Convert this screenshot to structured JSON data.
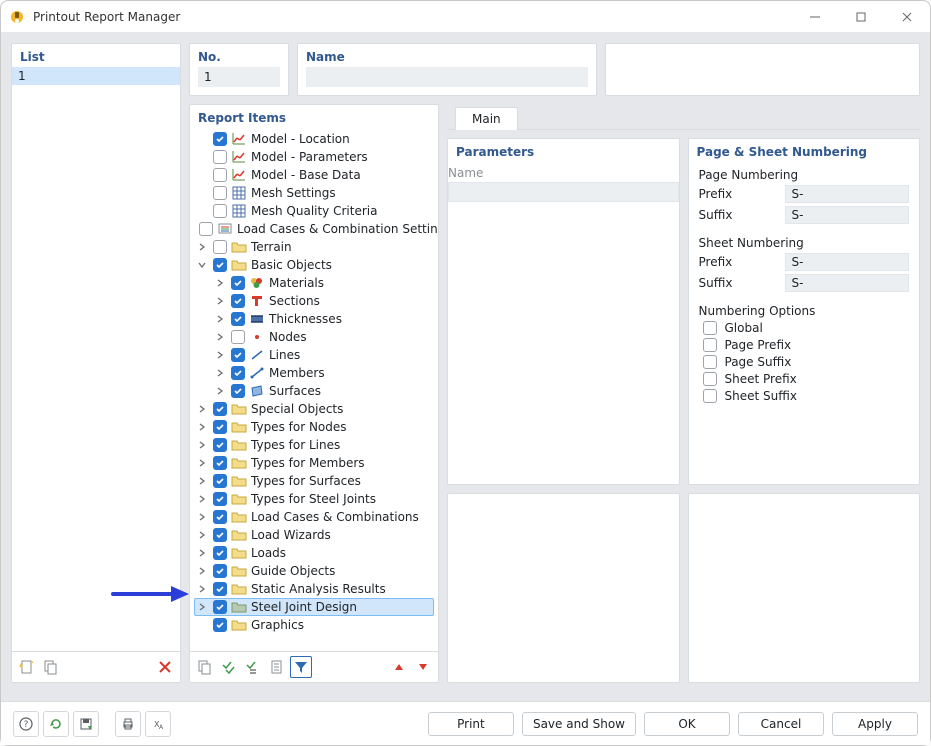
{
  "window": {
    "title": "Printout Report Manager"
  },
  "list": {
    "heading": "List",
    "items": [
      "1"
    ]
  },
  "hdr": {
    "no_label": "No.",
    "no_value": "1",
    "name_label": "Name",
    "name_value": ""
  },
  "tree": {
    "heading": "Report Items",
    "items": [
      {
        "depth": 0,
        "exp": "",
        "chk": true,
        "icon": "chart-green",
        "label": "Model - Location"
      },
      {
        "depth": 0,
        "exp": "",
        "chk": false,
        "icon": "chart-green",
        "label": "Model - Parameters"
      },
      {
        "depth": 0,
        "exp": "",
        "chk": false,
        "icon": "chart-green",
        "label": "Model - Base Data"
      },
      {
        "depth": 0,
        "exp": "",
        "chk": false,
        "icon": "mesh",
        "label": "Mesh Settings"
      },
      {
        "depth": 0,
        "exp": "",
        "chk": false,
        "icon": "mesh",
        "label": "Mesh Quality Criteria"
      },
      {
        "depth": 0,
        "exp": "",
        "chk": false,
        "icon": "load",
        "label": "Load Cases & Combination Settings"
      },
      {
        "depth": 0,
        "exp": "closed",
        "chk": false,
        "icon": "folder",
        "label": "Terrain"
      },
      {
        "depth": 0,
        "exp": "open",
        "chk": true,
        "icon": "folder",
        "label": "Basic Objects"
      },
      {
        "depth": 1,
        "exp": "closed",
        "chk": true,
        "icon": "materials",
        "label": "Materials"
      },
      {
        "depth": 1,
        "exp": "closed",
        "chk": true,
        "icon": "section",
        "label": "Sections"
      },
      {
        "depth": 1,
        "exp": "closed",
        "chk": true,
        "icon": "thickness",
        "label": "Thicknesses"
      },
      {
        "depth": 1,
        "exp": "closed",
        "chk": false,
        "icon": "node",
        "label": "Nodes"
      },
      {
        "depth": 1,
        "exp": "closed",
        "chk": true,
        "icon": "line",
        "label": "Lines"
      },
      {
        "depth": 1,
        "exp": "closed",
        "chk": true,
        "icon": "member",
        "label": "Members"
      },
      {
        "depth": 1,
        "exp": "closed",
        "chk": true,
        "icon": "surface",
        "label": "Surfaces"
      },
      {
        "depth": 0,
        "exp": "closed",
        "chk": true,
        "icon": "folder",
        "label": "Special Objects"
      },
      {
        "depth": 0,
        "exp": "closed",
        "chk": true,
        "icon": "folder",
        "label": "Types for Nodes"
      },
      {
        "depth": 0,
        "exp": "closed",
        "chk": true,
        "icon": "folder",
        "label": "Types for Lines"
      },
      {
        "depth": 0,
        "exp": "closed",
        "chk": true,
        "icon": "folder",
        "label": "Types for Members"
      },
      {
        "depth": 0,
        "exp": "closed",
        "chk": true,
        "icon": "folder",
        "label": "Types for Surfaces"
      },
      {
        "depth": 0,
        "exp": "closed",
        "chk": true,
        "icon": "folder",
        "label": "Types for Steel Joints"
      },
      {
        "depth": 0,
        "exp": "closed",
        "chk": true,
        "icon": "folder",
        "label": "Load Cases & Combinations"
      },
      {
        "depth": 0,
        "exp": "closed",
        "chk": true,
        "icon": "folder",
        "label": "Load Wizards"
      },
      {
        "depth": 0,
        "exp": "closed",
        "chk": true,
        "icon": "folder",
        "label": "Loads"
      },
      {
        "depth": 0,
        "exp": "closed",
        "chk": true,
        "icon": "folder",
        "label": "Guide Objects"
      },
      {
        "depth": 0,
        "exp": "closed",
        "chk": true,
        "icon": "folder",
        "label": "Static Analysis Results"
      },
      {
        "depth": 0,
        "exp": "closed",
        "chk": true,
        "icon": "folder-sel",
        "label": "Steel Joint Design",
        "selected": true
      },
      {
        "depth": 0,
        "exp": "",
        "chk": true,
        "icon": "folder",
        "label": "Graphics"
      }
    ]
  },
  "tabs": {
    "main": "Main"
  },
  "params": {
    "heading": "Parameters",
    "name_label": "Name",
    "name_value": ""
  },
  "page": {
    "heading": "Page & Sheet Numbering",
    "page_numbering_heading": "Page Numbering",
    "sheet_numbering_heading": "Sheet Numbering",
    "prefix_label": "Prefix",
    "suffix_label": "Suffix",
    "page_prefix_value": "S-",
    "page_suffix_value": "S-",
    "sheet_prefix_value": "S-",
    "sheet_suffix_value": "S-",
    "numbering_options_heading": "Numbering Options",
    "options": [
      "Global",
      "Page Prefix",
      "Page Suffix",
      "Sheet Prefix",
      "Sheet Suffix"
    ]
  },
  "buttons": {
    "print": "Print",
    "save_show": "Save and Show",
    "ok": "OK",
    "cancel": "Cancel",
    "apply": "Apply"
  }
}
